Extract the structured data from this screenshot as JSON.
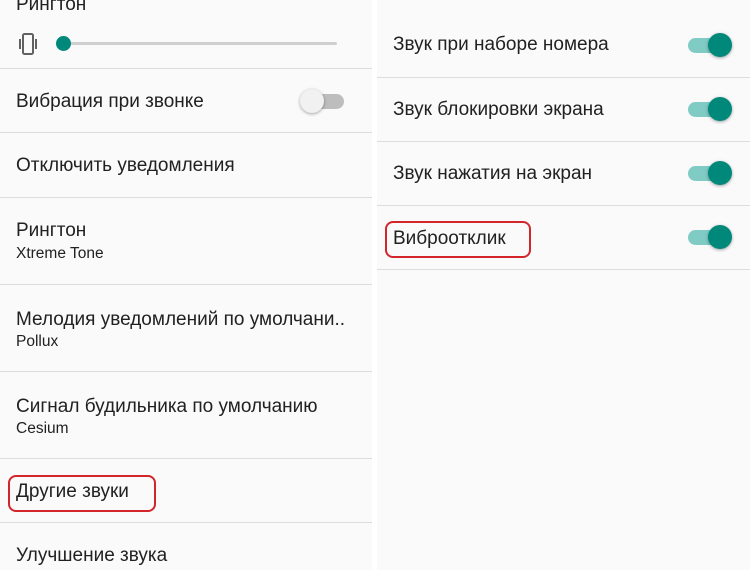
{
  "left_panel": {
    "ringtone_volume": {
      "title_cut": "Рингтон",
      "level": 0.0
    },
    "items": [
      {
        "key": "vibrate_on_ring",
        "title": "Вибрация при звонке",
        "switch_on": false
      },
      {
        "key": "mute_notifications",
        "title": "Отключить уведомления"
      },
      {
        "key": "ringtone",
        "title": "Рингтон",
        "subtitle": "Xtreme Tone"
      },
      {
        "key": "notification_tone",
        "title": "Мелодия уведомлений по умолчани..",
        "subtitle": "Pollux"
      },
      {
        "key": "alarm_tone",
        "title": "Сигнал будильника по умолчанию",
        "subtitle": "Cesium"
      },
      {
        "key": "other_sounds",
        "title": "Другие звуки",
        "highlighted": true
      },
      {
        "key": "sound_enhancement",
        "title": "Улучшение звука"
      }
    ]
  },
  "right_panel": {
    "items": [
      {
        "key": "dial_pad_tones",
        "title": "Звук при наборе номера",
        "switch_on": true
      },
      {
        "key": "screen_lock_sound",
        "title": "Звук блокировки экрана",
        "switch_on": true
      },
      {
        "key": "touch_sounds",
        "title": "Звук нажатия на экран",
        "switch_on": true
      },
      {
        "key": "vibrate_on_touch",
        "title": "Виброотклик",
        "switch_on": true,
        "highlighted": true
      }
    ]
  },
  "colors": {
    "accent": "#00897b",
    "accent_track": "#80cbc4",
    "highlight": "#d2262b",
    "top_strip": "#ecc9a3"
  },
  "icons": {
    "vibrate": "vibrate-icon"
  }
}
